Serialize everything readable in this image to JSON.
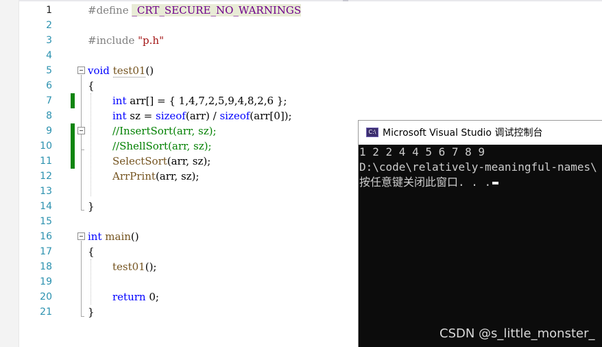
{
  "editor": {
    "line_numbers": [
      "1",
      "2",
      "3",
      "4",
      "5",
      "6",
      "7",
      "8",
      "9",
      "10",
      "11",
      "12",
      "13",
      "14",
      "15",
      "16",
      "17",
      "18",
      "19",
      "20",
      "21"
    ],
    "tokens": {
      "define": "#define",
      "macro": "_CRT_SECURE_NO_WARNINGS",
      "include": "#include",
      "include_file": "\"p.h\"",
      "void": "void",
      "test01_name": "test01",
      "parens": "()",
      "open_brace": "{",
      "close_brace": "}",
      "int": "int",
      "arr_decl": "arr[] = { 1,4,7,2,5,9,4,8,2,6 };",
      "sz_mid": "sz = ",
      "sizeof": "sizeof",
      "sizeof_arr": "(arr) / ",
      "sizeof_arr0": "(arr[0]);",
      "comment_insert": "//InsertSort(arr, sz);",
      "comment_shell": "//ShellSort(arr, sz);",
      "select_call": "SelectSort",
      "select_args": "(arr, sz);",
      "print_call": "ArrPrint",
      "print_args": "(arr, sz);",
      "main_name": "main",
      "test01_call": "test01",
      "call_args": "();",
      "return": "return",
      "return_val": " 0;"
    }
  },
  "console": {
    "title": "Microsoft Visual Studio 调试控制台",
    "icon_label": "C:\\",
    "icon": "console-app-icon",
    "lines": [
      "1 2 2 4 4 5 6 7 8 9",
      "D:\\code\\relatively-meaningful-names\\",
      "按任意键关闭此窗口. . ."
    ]
  },
  "watermark": "CSDN @s_little_monster_",
  "colors": {
    "keyword": "#0000ff",
    "preprocessor": "#808080",
    "macro": "#6f008a",
    "string": "#a31515",
    "comment": "#008000",
    "function": "#74531f",
    "line_number": "#2b91af",
    "change_bar": "#108510",
    "console_bg": "#0c0c0c",
    "console_text": "#cccccc"
  }
}
